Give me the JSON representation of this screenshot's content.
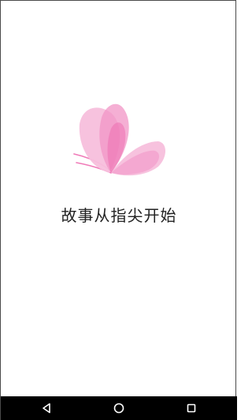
{
  "splash": {
    "logo_icon": "butterfly-icon",
    "tagline": "故事从指尖开始",
    "colors": {
      "wing_light": "#f7bfdc",
      "wing_mid": "#f294c6",
      "wing_deep": "#ec6fb0",
      "antenna": "#f07ab8",
      "text": "#222222",
      "background": "#ffffff"
    }
  },
  "navigation_bar": {
    "background": "#000000",
    "buttons": [
      {
        "icon": "back-triangle-icon"
      },
      {
        "icon": "home-circle-icon"
      },
      {
        "icon": "recents-square-icon"
      }
    ]
  }
}
